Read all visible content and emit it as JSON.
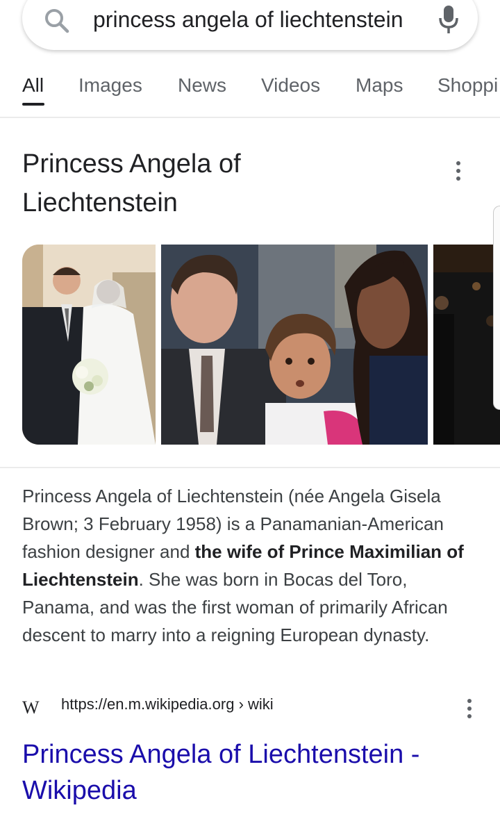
{
  "search": {
    "query": "princess angela of liechtenstein"
  },
  "tabs": [
    {
      "label": "All",
      "active": true
    },
    {
      "label": "Images"
    },
    {
      "label": "News"
    },
    {
      "label": "Videos"
    },
    {
      "label": "Maps"
    },
    {
      "label": "Shoppi"
    }
  ],
  "knowledge_panel": {
    "title": "Princess Angela of Liechtenstein",
    "description_parts": [
      "Princess Angela of Liechtenstein (née Angela Gisela Brown; 3 February 1958) is a Panamanian-American fashion designer and ",
      "the wife of Prince Maximilian of Liechtenstein",
      ". She was born in Bocas del Toro, Panama, and was the first woman of primarily African descent to marry into a reigning European dynasty."
    ],
    "source": {
      "icon_letter": "W",
      "url": "https://en.m.wikipedia.org › wiki"
    },
    "result_title": "Princess Angela of Liechtenstein - Wikipedia"
  },
  "icons": {
    "search": "search-icon",
    "mic": "mic-icon",
    "more": "more-options-icon"
  },
  "colors": {
    "link": "#1a0dab",
    "text": "#202124",
    "muted": "#5f6368"
  }
}
